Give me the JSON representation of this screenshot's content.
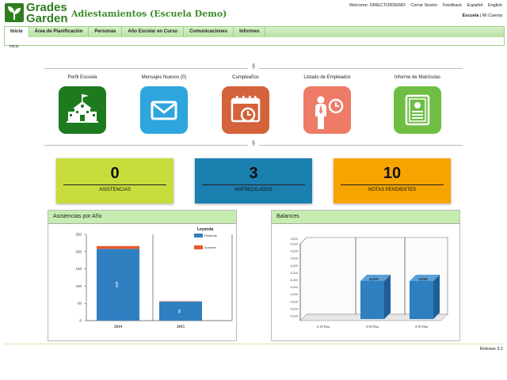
{
  "header": {
    "logo_line1": "Grades",
    "logo_line2": "Garden",
    "title": "Adiestamientos (Escuela Demo)",
    "welcome": "Welcome: DIRECTORDEMO",
    "links": [
      "Cerrar Sesión",
      "Feedback",
      "Español",
      "English"
    ],
    "school_label": "Escuela",
    "school_sep": "|",
    "account_label": "Mi Cuenta"
  },
  "nav": {
    "items": [
      "Inicio",
      "Área de Planificación",
      "Personas",
      "Año Escolar en Curso",
      "Comunicaciones",
      "Informes"
    ],
    "active": "Inicio",
    "sub_item": "Inicio"
  },
  "divider_mark": "§",
  "shortcuts": [
    {
      "label": "Perfil Escuela",
      "icon": "school-icon",
      "color": "#1e7a1e"
    },
    {
      "label": "Mensajes Nuevos (0)",
      "icon": "mail-icon",
      "color": "#2ea6dd"
    },
    {
      "label": "Cumpleaños",
      "icon": "calendar-clock-icon",
      "color": "#d4623a"
    },
    {
      "label": "Listado de Empleados",
      "icon": "employee-clock-icon",
      "color": "#ee7b66"
    },
    {
      "label": "Informe de Matrículas",
      "icon": "certificate-icon",
      "color": "#6fbe44"
    }
  ],
  "stats": [
    {
      "value": "0",
      "label": "ASISTENCIAS",
      "color": "#c8dc3c"
    },
    {
      "value": "3",
      "label": "MATRICULADOS",
      "color": "#1b7fb0"
    },
    {
      "value": "10",
      "label": "NOTAS PENDIENTES",
      "color": "#f6a400"
    }
  ],
  "panels": {
    "attendance_title": "Asistencias por Año",
    "balances_title": "Balances"
  },
  "chart_data": [
    {
      "type": "bar",
      "title": "",
      "legend_title": "Leyenda",
      "categories": [
        "2014",
        "2015"
      ],
      "series": [
        {
          "name": "Presente",
          "values": [
            208,
            55
          ],
          "color": "#2f7fc1"
        },
        {
          "name": "Ausente",
          "values": [
            8,
            1
          ],
          "color": "#e8582c"
        }
      ],
      "data_labels": [
        "208",
        "55"
      ],
      "yticks": [
        0,
        50,
        100,
        150,
        200,
        250
      ],
      "ylim": [
        0,
        250
      ],
      "legend": "top-right"
    },
    {
      "type": "bar",
      "title": "",
      "categories": [
        "A 30 Días",
        "A 60 Días",
        "A 90 Días"
      ],
      "values": [
        0,
        4.21,
        4.21
      ],
      "data_labels": [
        "",
        "4,210",
        "4,210"
      ],
      "yticks": [
        "4,210",
        "4,210",
        "4,210",
        "4,210",
        "4,210",
        "4,210",
        "4,210",
        "4,210",
        "4,210",
        "4,210",
        "4,210"
      ],
      "top_tick": "4,211",
      "color": "#2f7fc1"
    }
  ],
  "release": "Release 3.2"
}
